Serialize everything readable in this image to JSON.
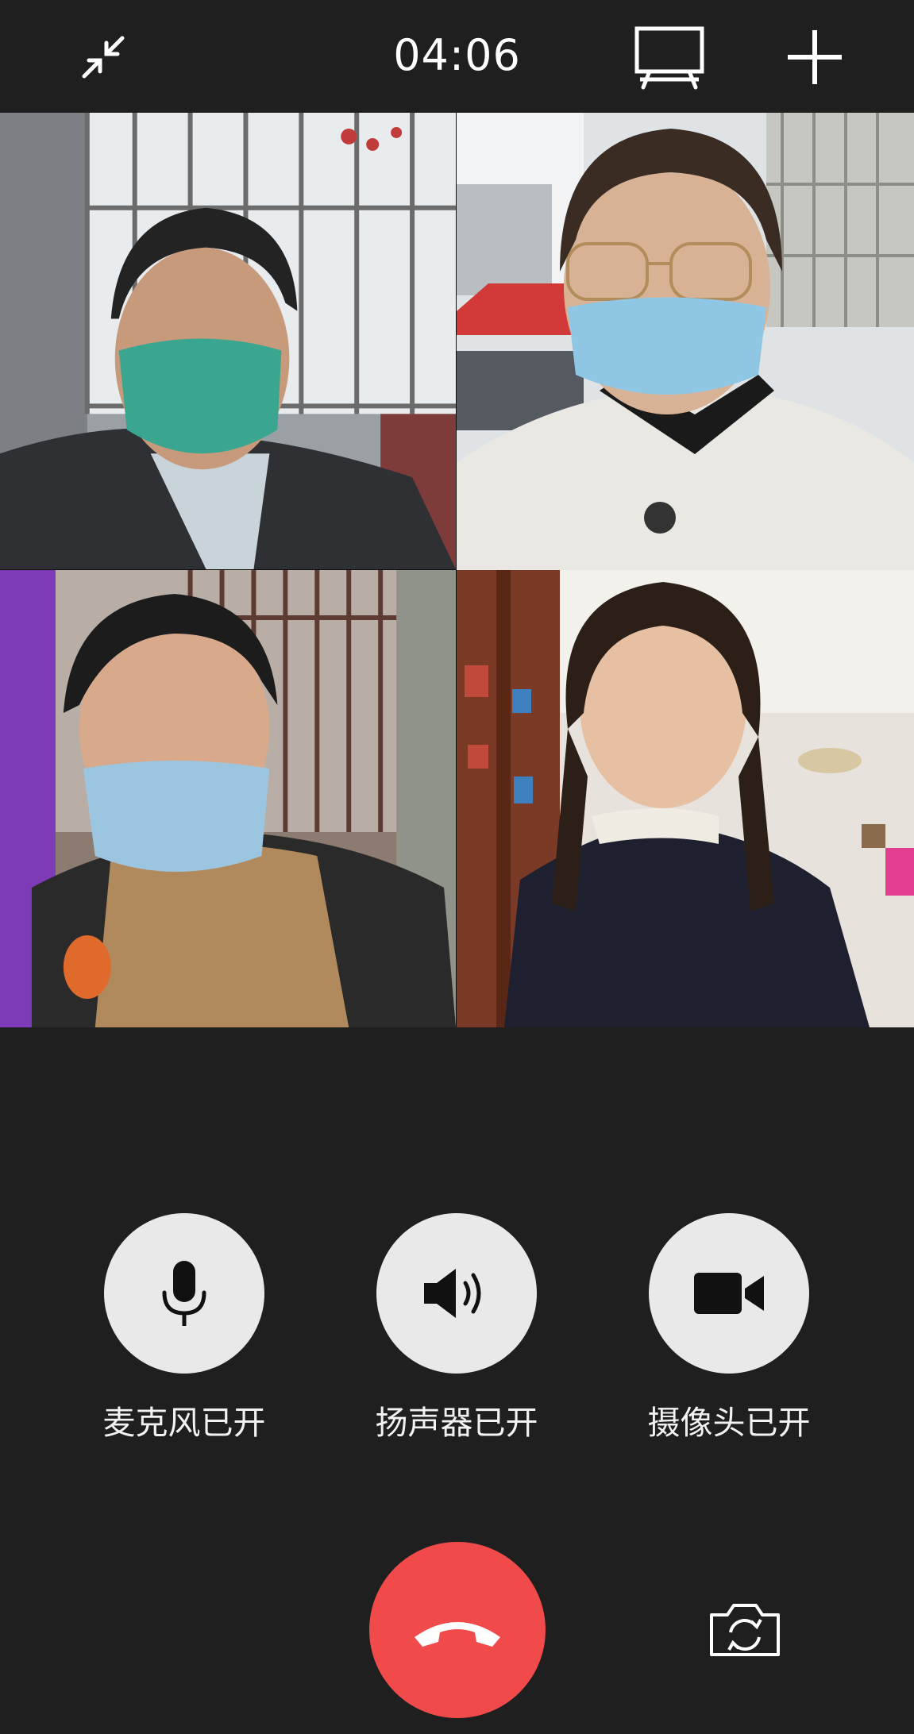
{
  "call": {
    "timer": "04:06",
    "minimize_icon": "minimize-arrows-icon",
    "screen_share_icon": "screen-share-icon",
    "add_icon": "plus-icon"
  },
  "participants": [
    {
      "name": "participant-1"
    },
    {
      "name": "participant-2"
    },
    {
      "name": "participant-3"
    },
    {
      "name": "participant-4"
    }
  ],
  "controls": {
    "mic_label": "麦克风已开",
    "speaker_label": "扬声器已开",
    "camera_label": "摄像头已开",
    "mic_icon": "microphone-icon",
    "speaker_icon": "speaker-icon",
    "camera_icon": "video-camera-icon",
    "hangup_icon": "phone-hangup-icon",
    "flip_icon": "camera-flip-icon"
  },
  "colors": {
    "background": "#1f1f1f",
    "control_circle": "#e9e9e9",
    "hangup": "#f04a4a"
  }
}
